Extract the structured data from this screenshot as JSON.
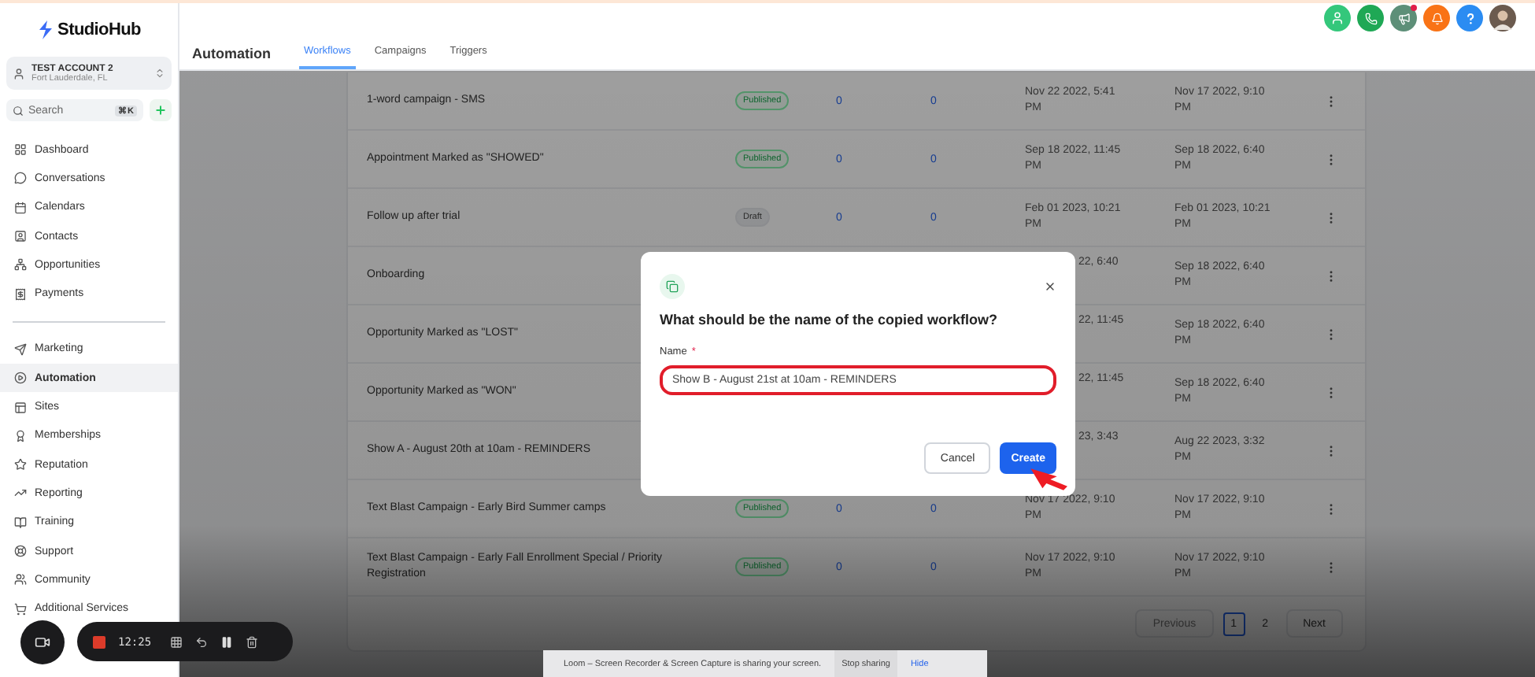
{
  "app": {
    "logo": "StudioHub"
  },
  "account": {
    "name": "TEST ACCOUNT 2",
    "location": "Fort Lauderdale, FL"
  },
  "search": {
    "placeholder": "Search",
    "shortcut": "⌘K"
  },
  "nav": [
    {
      "label": "Dashboard",
      "selected": false
    },
    {
      "label": "Conversations",
      "selected": false
    },
    {
      "label": "Calendars",
      "selected": false
    },
    {
      "label": "Contacts",
      "selected": false
    },
    {
      "label": "Opportunities",
      "selected": false
    },
    {
      "label": "Payments",
      "selected": false
    },
    {
      "label": "Marketing",
      "selected": false
    },
    {
      "label": "Automation",
      "selected": true
    },
    {
      "label": "Sites",
      "selected": false
    },
    {
      "label": "Memberships",
      "selected": false
    },
    {
      "label": "Reputation",
      "selected": false
    },
    {
      "label": "Reporting",
      "selected": false
    },
    {
      "label": "Training",
      "selected": false
    },
    {
      "label": "Support",
      "selected": false
    },
    {
      "label": "Community",
      "selected": false
    },
    {
      "label": "Additional Services",
      "selected": false
    }
  ],
  "header": {
    "title": "Automation",
    "tabs": [
      {
        "label": "Workflows",
        "selected": true
      },
      {
        "label": "Campaigns",
        "selected": false
      },
      {
        "label": "Triggers",
        "selected": false
      }
    ]
  },
  "rows": [
    {
      "name": "1-word campaign - SMS",
      "status": "Published",
      "kind": "published",
      "count_1": "0",
      "count_2": "0",
      "updated": "Nov 22 2022, 5:41 PM",
      "created": "Nov 17 2022, 9:10 PM"
    },
    {
      "name": "Appointment Marked as \"SHOWED\"",
      "status": "Published",
      "kind": "published",
      "count_1": "0",
      "count_2": "0",
      "updated": "Sep 18 2022, 11:45 PM",
      "created": "Sep 18 2022, 6:40 PM"
    },
    {
      "name": "Follow up after trial",
      "status": "Draft",
      "kind": "draft",
      "count_1": "0",
      "count_2": "0",
      "updated": "Feb 01 2023, 10:21 PM",
      "created": "Feb 01 2023, 10:21 PM"
    },
    {
      "name": "Onboarding",
      "updated": "22, 6:40",
      "created": "Sep 18 2022, 6:40 PM"
    },
    {
      "name": "Opportunity Marked as \"LOST\"",
      "updated": "22, 11:45",
      "created": "Sep 18 2022, 6:40 PM"
    },
    {
      "name": "Opportunity Marked as \"WON\"",
      "updated": "22, 11:45",
      "created": "Sep 18 2022, 6:40 PM"
    },
    {
      "name": "Show A - August 20th at 10am - REMINDERS",
      "updated": "23, 3:43",
      "created": "Aug 22 2023, 3:32 PM"
    },
    {
      "name": "Text Blast Campaign - Early Bird Summer camps",
      "status": "Published",
      "kind": "published",
      "count_1": "0",
      "count_2": "0",
      "updated": "Nov 17 2022, 9:10 PM",
      "created": "Nov 17 2022, 9:10 PM"
    },
    {
      "name": "Text Blast Campaign - Early Fall Enrollment Special / Priority Registration",
      "status": "Published",
      "kind": "published",
      "count_1": "0",
      "count_2": "0",
      "updated": "Nov 17 2022, 9:10 PM",
      "created": "Nov 17 2022, 9:10 PM"
    }
  ],
  "pagination": {
    "previous": "Previous",
    "pages": [
      {
        "label": "1",
        "selected": true
      },
      {
        "label": "2",
        "selected": false
      }
    ],
    "next": "Next"
  },
  "modal": {
    "title": "What should be the name of the copied workflow?",
    "field_label": "Name",
    "required_mark": "*",
    "value": "Show B - August 21st at 10am - REMINDERS",
    "cancel": "Cancel",
    "create": "Create"
  },
  "recorder": {
    "time": "12:25"
  },
  "banner": {
    "message": "Loom – Screen Recorder & Screen Capture is sharing your screen.",
    "stop": "Stop sharing",
    "hide": "Hide"
  }
}
